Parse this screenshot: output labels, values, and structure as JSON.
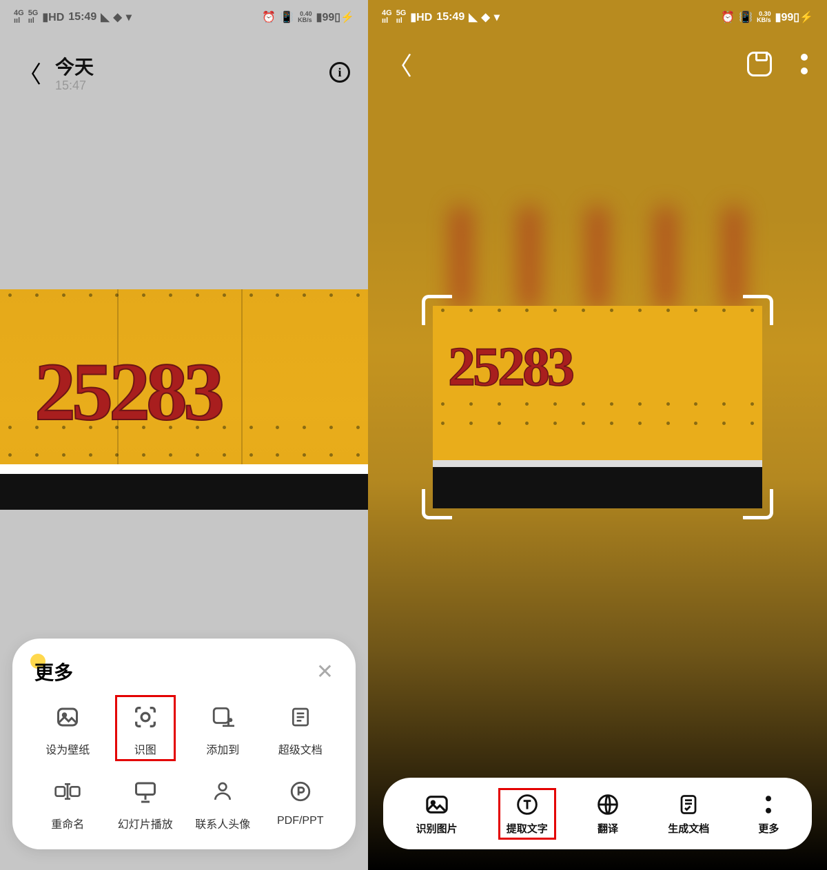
{
  "status": {
    "signals": [
      "4G",
      "5G"
    ],
    "hd": "HD|2",
    "time": "15:49",
    "rate_left": "0.40",
    "rate_right": "0.30",
    "rate_unit": "KB/s",
    "battery": "99"
  },
  "left": {
    "title": "今天",
    "subtitle": "15:47",
    "image_number": "25283",
    "sheet_title": "更多",
    "actions": [
      {
        "id": "set-wallpaper",
        "label": "设为壁纸",
        "icon": "image-icon"
      },
      {
        "id": "recognize",
        "label": "识图",
        "icon": "scan-icon",
        "highlight": true
      },
      {
        "id": "add-to",
        "label": "添加到",
        "icon": "add-square-icon"
      },
      {
        "id": "super-doc",
        "label": "超级文档",
        "icon": "document-lines-icon"
      },
      {
        "id": "rename",
        "label": "重命名",
        "icon": "rename-icon"
      },
      {
        "id": "slideshow",
        "label": "幻灯片播放",
        "icon": "presentation-icon"
      },
      {
        "id": "contact-avatar",
        "label": "联系人头像",
        "icon": "person-icon"
      },
      {
        "id": "pdf-ppt",
        "label": "PDF/PPT",
        "icon": "file-p-icon"
      }
    ]
  },
  "right": {
    "image_number": "25283",
    "actions": [
      {
        "id": "recognize-image",
        "label": "识别图片",
        "icon": "image-icon"
      },
      {
        "id": "extract-text",
        "label": "提取文字",
        "icon": "text-circle-icon",
        "highlight": true
      },
      {
        "id": "translate",
        "label": "翻译",
        "icon": "globe-icon"
      },
      {
        "id": "generate-doc",
        "label": "生成文档",
        "icon": "doc-check-icon"
      },
      {
        "id": "more",
        "label": "更多",
        "icon": "dots-icon"
      }
    ]
  }
}
